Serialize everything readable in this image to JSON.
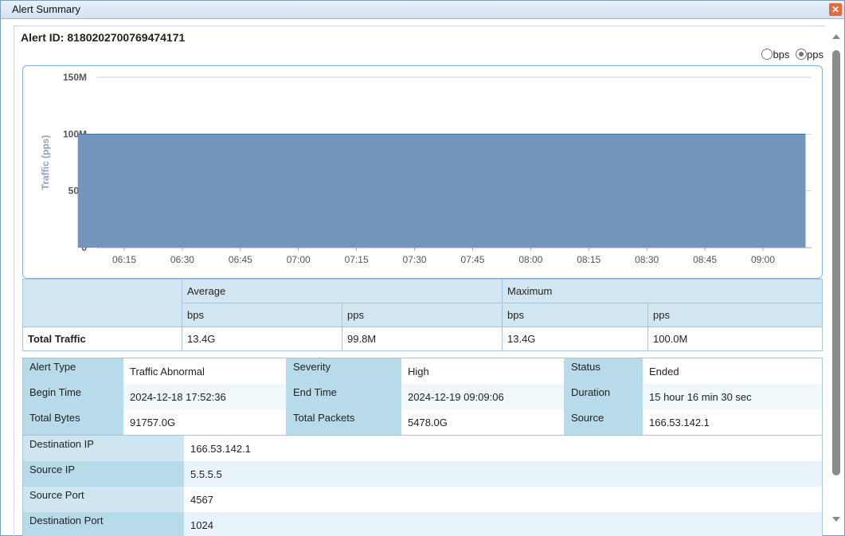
{
  "window": {
    "title": "Alert Summary",
    "close_label": "✕"
  },
  "alert": {
    "id_label": "Alert ID:",
    "id_value": "8180202700769474171"
  },
  "units": {
    "selected": "pps",
    "options": [
      "bps",
      "pps"
    ]
  },
  "chart_data": {
    "type": "area",
    "ylabel": "Traffic (pps)",
    "xlabel": "",
    "title": "",
    "ylim": [
      0,
      150000000
    ],
    "yticks": [
      "0",
      "50M",
      "100M",
      "150M"
    ],
    "xticks": [
      "06:15",
      "06:30",
      "06:45",
      "07:00",
      "07:15",
      "07:30",
      "07:45",
      "08:00",
      "08:15",
      "08:30",
      "08:45",
      "09:00"
    ],
    "series": [
      {
        "x": [
          "06:03",
          "09:11"
        ],
        "values": [
          100000000,
          100000000
        ]
      }
    ],
    "grid": true,
    "color": "#7295bc"
  },
  "traffic_table": {
    "average": "Average",
    "maximum": "Maximum",
    "bps": "bps",
    "pps": "pps",
    "row_label": "Total Traffic",
    "values": [
      "13.4G",
      "99.8M",
      "13.4G",
      "100.0M"
    ]
  },
  "info": [
    [
      {
        "label": "Alert Type",
        "value": "Traffic Abnormal"
      },
      {
        "label": "Severity",
        "value": "High"
      },
      {
        "label": "Status",
        "value": "Ended"
      }
    ],
    [
      {
        "label": "Begin Time",
        "value": "2024-12-18 17:52:36"
      },
      {
        "label": "End Time",
        "value": "2024-12-19 09:09:06"
      },
      {
        "label": "Duration",
        "value": "15 hour 16 min 30 sec"
      }
    ],
    [
      {
        "label": "Total Bytes",
        "value": "91757.0G"
      },
      {
        "label": "Total Packets",
        "value": "5478.0G"
      },
      {
        "label": "Source",
        "value": "166.53.142.1"
      }
    ]
  ],
  "ips": [
    {
      "label": "Destination IP",
      "value": "166.53.142.1"
    },
    {
      "label": "Source IP",
      "value": "5.5.5.5"
    },
    {
      "label": "Source Port",
      "value": "4567"
    },
    {
      "label": "Destination Port",
      "value": "1024"
    }
  ]
}
